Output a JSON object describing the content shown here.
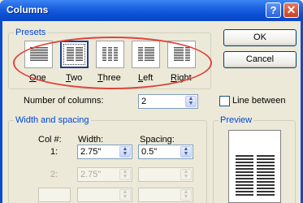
{
  "window": {
    "title": "Columns",
    "help": "?",
    "close": "✕"
  },
  "presets": {
    "legend": "Presets",
    "items": [
      {
        "label": "One",
        "selected": false
      },
      {
        "label": "Two",
        "selected": true
      },
      {
        "label": "Three",
        "selected": false
      },
      {
        "label": "Left",
        "selected": false
      },
      {
        "label": "Right",
        "selected": false
      }
    ]
  },
  "buttons": {
    "ok": "OK",
    "cancel": "Cancel"
  },
  "num_columns": {
    "label": "Number of columns:",
    "value": "2"
  },
  "line_between": {
    "label": "Line between",
    "checked": false
  },
  "width_spacing": {
    "legend": "Width and spacing",
    "col_header": "Col #:",
    "width_header": "Width:",
    "spacing_header": "Spacing:",
    "rows": [
      {
        "col": "1:",
        "width": "2.75\"",
        "spacing": "0.5\"",
        "enabled": true
      },
      {
        "col": "2:",
        "width": "2.75\"",
        "spacing": "",
        "enabled": false
      },
      {
        "col": "",
        "width": "",
        "spacing": "",
        "enabled": false
      }
    ]
  },
  "preview": {
    "legend": "Preview"
  },
  "annotation": {
    "color": "#E0443A"
  }
}
